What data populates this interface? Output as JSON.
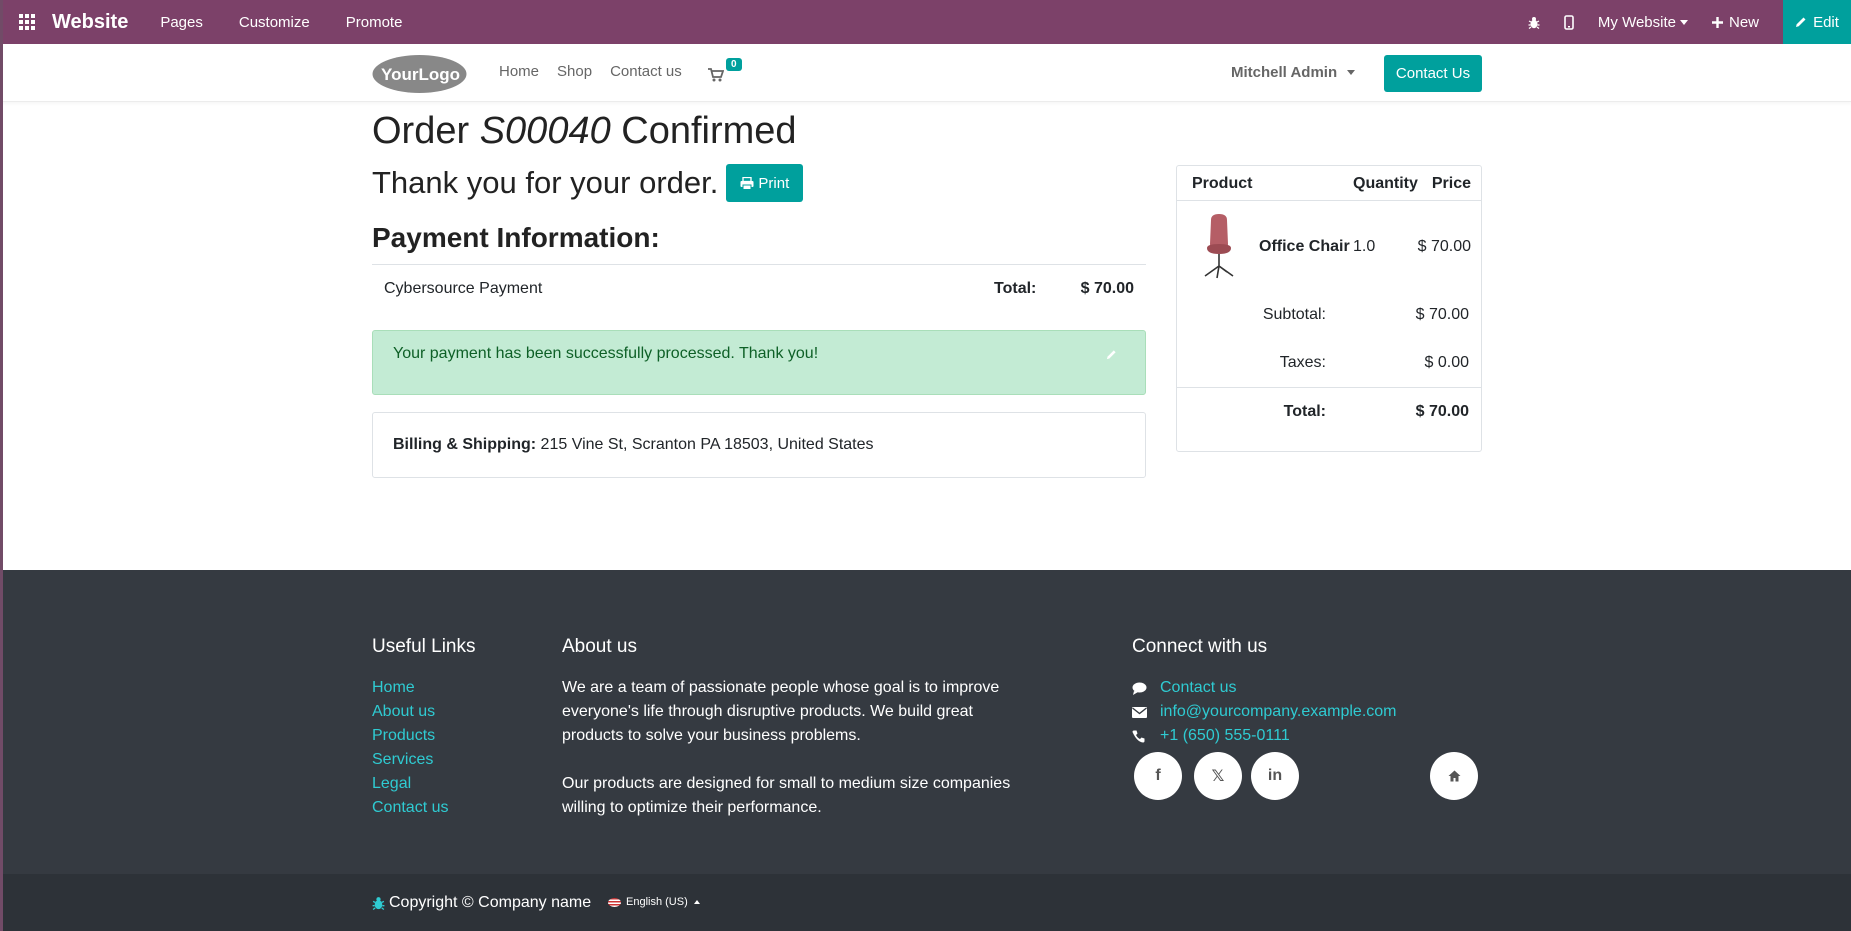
{
  "admin_bar": {
    "brand": "Website",
    "menu": [
      "Pages",
      "Customize",
      "Promote"
    ],
    "my_website": "My Website",
    "new_label": "New",
    "edit_label": "Edit"
  },
  "header": {
    "logo_text": "YourLogo",
    "nav": [
      "Home",
      "Shop",
      "Contact us"
    ],
    "cart_count": "0",
    "user": "Mitchell Admin",
    "contact_button": "Contact Us"
  },
  "order": {
    "title_prefix": "Order",
    "order_ref": "S00040",
    "title_suffix": "Confirmed",
    "thanks": "Thank you for your order.",
    "print_label": "Print",
    "payment_title": "Payment Information:",
    "payment_method": "Cybersource Payment",
    "total_label": "Total:",
    "total_value": "$ 70.00",
    "success_message": "Your payment has been successfully processed. Thank you!",
    "billing_label": "Billing & Shipping:",
    "billing_address": "215 Vine St, Scranton PA 18503, United States"
  },
  "summary": {
    "headers": {
      "product": "Product",
      "quantity": "Quantity",
      "price": "Price"
    },
    "item": {
      "name": "Office Chair",
      "quantity": "1.0",
      "price": "$ 70.00"
    },
    "subtotal_label": "Subtotal:",
    "subtotal_value": "$ 70.00",
    "taxes_label": "Taxes:",
    "taxes_value": "$ 0.00",
    "total_label": "Total:",
    "total_value": "$ 70.00"
  },
  "footer": {
    "useful_links_title": "Useful Links",
    "useful_links": [
      "Home",
      "About us",
      "Products",
      "Services",
      "Legal",
      "Contact us"
    ],
    "about_title": "About us",
    "about_p1": "We are a team of passionate people whose goal is to improve everyone's life through disruptive products. We build great products to solve your business problems.",
    "about_p2": "Our products are designed for small to medium size companies willing to optimize their performance.",
    "connect_title": "Connect with us",
    "connect_contact": "Contact us",
    "connect_email": "info@yourcompany.example.com",
    "connect_phone": "+1 (650) 555-0111",
    "social": {
      "facebook": "f",
      "x": "𝕏",
      "linkedin": "in"
    },
    "copyright": "Copyright © Company name",
    "language": "English (US)"
  },
  "colors": {
    "admin_bar": "#7c4169",
    "accent": "#00a09d",
    "footer_bg": "#353a41",
    "footer_link": "#2fcbd2",
    "alert_bg": "#c3ebd4"
  },
  "icons": [
    "apps-grid-icon",
    "bug-icon",
    "mobile-icon",
    "plus-icon",
    "pencil-icon",
    "cart-icon",
    "printer-icon",
    "comment-icon",
    "envelope-icon",
    "phone-icon",
    "home-icon"
  ]
}
